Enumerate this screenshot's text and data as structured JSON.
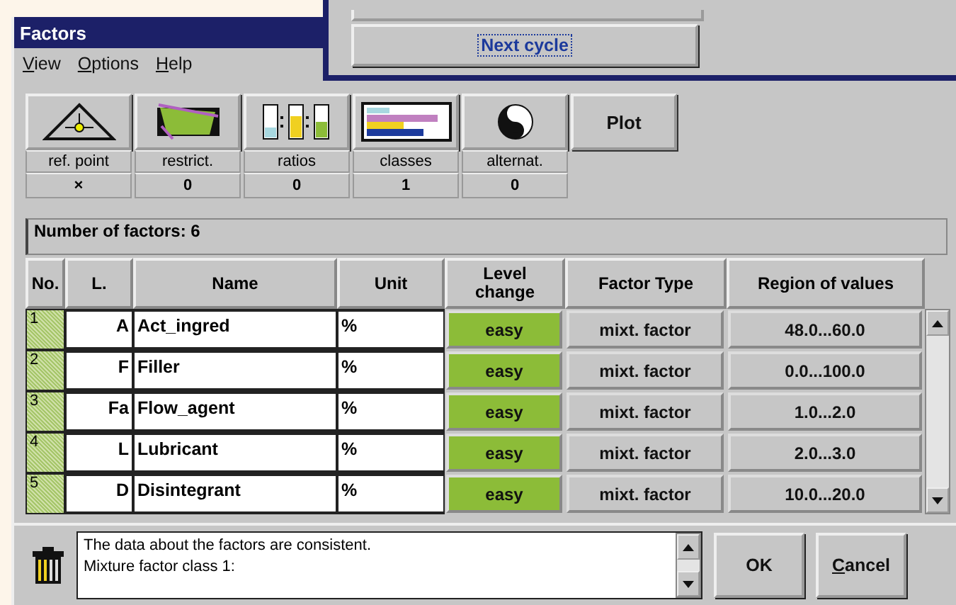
{
  "window": {
    "title": "Factors"
  },
  "menu": [
    "View",
    "Options",
    "Help"
  ],
  "tools": [
    {
      "kind": "ref-point",
      "label": "ref. point",
      "value": "×"
    },
    {
      "kind": "restrict",
      "label": "restrict.",
      "value": "0"
    },
    {
      "kind": "ratios",
      "label": "ratios",
      "value": "0"
    },
    {
      "kind": "classes",
      "label": "classes",
      "value": "1"
    },
    {
      "kind": "alternat",
      "label": "alternat.",
      "value": "0"
    }
  ],
  "plot_button": "Plot",
  "factor_count": "Number of factors: 6",
  "table": {
    "columns": [
      "No.",
      "L.",
      "Name",
      "Unit",
      "Level change",
      "Factor Type",
      "Region of values"
    ],
    "rows": [
      {
        "no": "1",
        "letter": "A",
        "name": "Act_ingred",
        "unit": "%",
        "level_change": "easy",
        "factor_type": "mixt. factor",
        "region": "48.0...60.0"
      },
      {
        "no": "2",
        "letter": "F",
        "name": "Filler",
        "unit": "%",
        "level_change": "easy",
        "factor_type": "mixt. factor",
        "region": "0.0...100.0"
      },
      {
        "no": "3",
        "letter": "Fa",
        "name": "Flow_agent",
        "unit": "%",
        "level_change": "easy",
        "factor_type": "mixt. factor",
        "region": "1.0...2.0"
      },
      {
        "no": "4",
        "letter": "L",
        "name": "Lubricant",
        "unit": "%",
        "level_change": "easy",
        "factor_type": "mixt. factor",
        "region": "2.0...3.0"
      },
      {
        "no": "5",
        "letter": "D",
        "name": "Disintegrant",
        "unit": "%",
        "level_change": "easy",
        "factor_type": "mixt. factor",
        "region": "10.0...20.0"
      }
    ]
  },
  "messages": [
    "The data about the factors are consistent.",
    "Mixture factor class 1:"
  ],
  "buttons": [
    "OK",
    "Cancel"
  ],
  "back_window": {
    "button": "Next cycle"
  }
}
